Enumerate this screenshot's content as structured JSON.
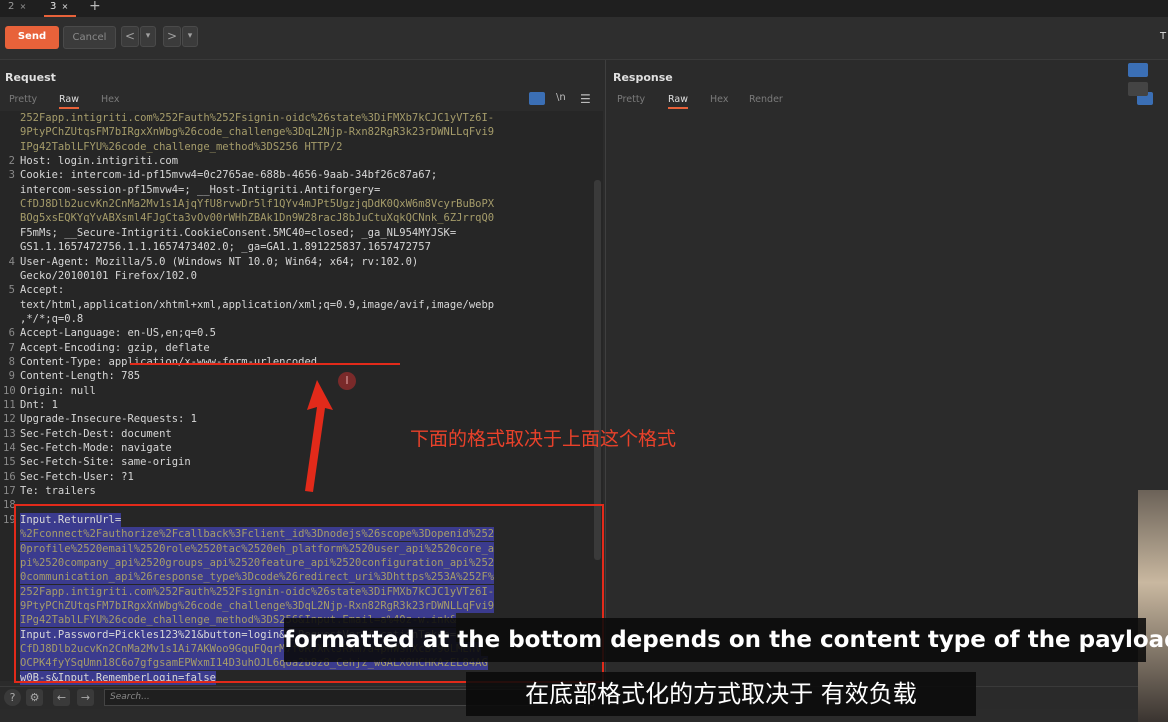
{
  "tabs": [
    {
      "label": "2",
      "close": "×"
    },
    {
      "label": "3",
      "close": "×",
      "active": true
    }
  ],
  "new_tab_label": "+",
  "toolbar": {
    "send_label": "Send",
    "cancel_label": "Cancel",
    "back_label": "<",
    "back_menu_label": "▾",
    "forward_label": ">",
    "forward_menu_label": "▾",
    "right_label": "T"
  },
  "request": {
    "title": "Request",
    "subtabs": [
      "Pretty",
      "Raw",
      "Hex"
    ],
    "active_subtab": "Raw",
    "icons": {
      "wrap": "wrap-icon",
      "newline": "\\n",
      "menu": "menu-icon"
    },
    "lines": [
      {
        "n": "",
        "t": "252Fapp.intigriti.com%252Fauth%252Fsignin-oidc%26state%3DiFMXb7kCJC1yVTz6I-",
        "c": "enc"
      },
      {
        "n": "",
        "t": "9PtyPChZUtqsFM7bIRgxXnWbg%26code_challenge%3DqL2Njp-Rxn82RgR3k23rDWNLLqFvi9",
        "c": "enc"
      },
      {
        "n": "",
        "t": "IPg42TablLFYU%26code_challenge_method%3DS256 HTTP/2",
        "c": "enc"
      },
      {
        "n": "2",
        "t": "Host: login.intigriti.com",
        "c": "hdr"
      },
      {
        "n": "3",
        "t": "Cookie: intercom-id-pf15mvw4=0c2765ae-688b-4656-9aab-34bf26c87a67;",
        "c": "hdr"
      },
      {
        "n": "",
        "t": "intercom-session-pf15mvw4=; __Host-Intigriti.Antiforgery=",
        "c": "hdr"
      },
      {
        "n": "",
        "t": "CfDJ8Dlb2ucvKn2CnMa2Mv1s1AjqYfU8rvwDr5lf1QYv4mJPt5UgzjqDdK0QxW6m8VcyrBuBoPX",
        "c": "enc"
      },
      {
        "n": "",
        "t": "BOg5xsEQKYqYvABXsml4FJgCta3vOv00rWHhZBAk1Dn9W28racJ8bJuCtuXqkQCNnk_6ZJrrqQ0",
        "c": "enc"
      },
      {
        "n": "",
        "t": "F5mMs; __Secure-Intigriti.CookieConsent.5MC40=closed; _ga_NL954MYJSK=",
        "c": "hdr"
      },
      {
        "n": "",
        "t": "GS1.1.1657472756.1.1.1657473402.0; _ga=GA1.1.891225837.1657472757",
        "c": "hdr"
      },
      {
        "n": "4",
        "t": "User-Agent: Mozilla/5.0 (Windows NT 10.0; Win64; x64; rv:102.0)",
        "c": "hdr"
      },
      {
        "n": "",
        "t": "Gecko/20100101 Firefox/102.0",
        "c": "hdr"
      },
      {
        "n": "5",
        "t": "Accept:",
        "c": "hdr"
      },
      {
        "n": "",
        "t": "text/html,application/xhtml+xml,application/xml;q=0.9,image/avif,image/webp",
        "c": "hdr"
      },
      {
        "n": "",
        "t": ",*/*;q=0.8",
        "c": "hdr"
      },
      {
        "n": "6",
        "t": "Accept-Language: en-US,en;q=0.5",
        "c": "hdr"
      },
      {
        "n": "7",
        "t": "Accept-Encoding: gzip, deflate",
        "c": "hdr"
      },
      {
        "n": "8",
        "t": "Content-Type: application/x-www-form-urlencoded",
        "c": "hdr"
      },
      {
        "n": "9",
        "t": "Content-Length: 785",
        "c": "hdr"
      },
      {
        "n": "10",
        "t": "Origin: null",
        "c": "hdr"
      },
      {
        "n": "11",
        "t": "Dnt: 1",
        "c": "hdr"
      },
      {
        "n": "12",
        "t": "Upgrade-Insecure-Requests: 1",
        "c": "hdr"
      },
      {
        "n": "13",
        "t": "Sec-Fetch-Dest: document",
        "c": "hdr"
      },
      {
        "n": "14",
        "t": "Sec-Fetch-Mode: navigate",
        "c": "hdr"
      },
      {
        "n": "15",
        "t": "Sec-Fetch-Site: same-origin",
        "c": "hdr"
      },
      {
        "n": "16",
        "t": "Sec-Fetch-User: ?1",
        "c": "hdr"
      },
      {
        "n": "17",
        "t": "Te: trailers",
        "c": "hdr"
      },
      {
        "n": "18",
        "t": "",
        "c": "hdr"
      },
      {
        "n": "19",
        "t": "Input.ReturnUrl=",
        "c": "hdr sel"
      },
      {
        "n": "",
        "t": "%2Fconnect%2Fauthorize%2Fcallback%3Fclient_id%3Dnodejs%26scope%3Dopenid%252",
        "c": "enc sel"
      },
      {
        "n": "",
        "t": "0profile%2520email%2520role%2520tac%2520eh_platform%2520user_api%2520core_a",
        "c": "enc sel"
      },
      {
        "n": "",
        "t": "pi%2520company_api%2520groups_api%2520feature_api%2520configuration_api%252",
        "c": "enc sel"
      },
      {
        "n": "",
        "t": "0communication_api%26response_type%3Dcode%26redirect_uri%3Dhttps%253A%252F%",
        "c": "enc sel"
      },
      {
        "n": "",
        "t": "252Fapp.intigriti.com%252Fauth%252Fsignin-oidc%26state%3DiFMXb7kCJC1yVTz6I-",
        "c": "enc sel"
      },
      {
        "n": "",
        "t": "9PtyPChZUtqsFM7bIRgxXnWbg%26code_challenge%3DqL2Njp-Rxn82RgR3k23rDWNLLqFvi9",
        "c": "enc sel"
      },
      {
        "n": "",
        "t": "IPg42TablLFYU%26code_challenge_method%3DS256&Input.Email=a%40z-w.ink&",
        "c": "enc sel"
      },
      {
        "n": "",
        "t": "Input.Password=Pickles123%21&button=login&__RequestVerificationToken=",
        "c": "hdr sel"
      },
      {
        "n": "",
        "t": "CfDJ8Dlb2ucvKn2CnMa2Mv1s1Ai7AKWoo9GquFQqrM7f0R7XKlJRxm7a4pnWsnXcBf96LMEnV",
        "c": "enc sel"
      },
      {
        "n": "",
        "t": "OCPK4fyYSqUmn18C6o7gfgsamEPWxmI14D3uhOJL6qoa2b8z8_Cehjz_wGALX0HCHKAzEL84AG",
        "c": "enc sel"
      },
      {
        "n": "",
        "t": "w0B-s&Input.RememberLogin=false",
        "c": "hdr sel"
      }
    ]
  },
  "response": {
    "title": "Response",
    "subtabs": [
      "Pretty",
      "Raw",
      "Hex",
      "Render"
    ],
    "active_subtab": "Raw"
  },
  "bottom": {
    "help_label": "?",
    "settings_label": "⚙",
    "prev_label": "←",
    "next_label": "→",
    "search_placeholder": "Search..."
  },
  "annotation": {
    "text": "下面的格式取决于上面这个格式",
    "color": "#e8412a"
  },
  "subtitles": {
    "english": "formatted at the bottom depends on the content type of the payload",
    "chinese": "在底部格式化的方式取决于 有效负载"
  },
  "colors": {
    "accent": "#e8623a",
    "highlight_red": "#e22a1a",
    "selection": "#3b3b8e"
  }
}
